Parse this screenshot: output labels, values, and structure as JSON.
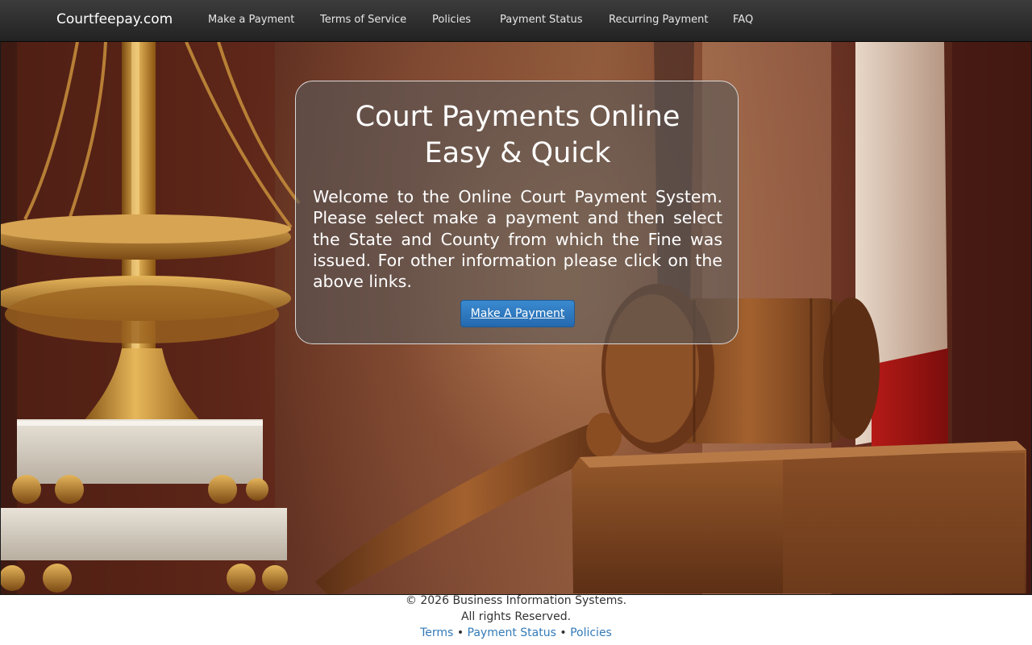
{
  "nav": {
    "brand": "Courtfeepay.com",
    "items": [
      {
        "label": "Make a Payment"
      },
      {
        "label": "Terms of Service"
      },
      {
        "label": "Policies"
      },
      {
        "label": "Payment Status"
      },
      {
        "label": "Recurring Payment"
      },
      {
        "label": "FAQ"
      }
    ]
  },
  "hero": {
    "title_line1": "Court Payments Online",
    "title_line2": "Easy & Quick",
    "body": "Welcome to the Online Court Payment System. Please select make a payment and then select the State and County from which the Fine was issued. For other information please click on the above links.",
    "cta_label": "Make A Payment"
  },
  "footer": {
    "copyright": "© 2026 Business Information Systems.",
    "rights": "All rights Reserved.",
    "links": [
      {
        "label": "Terms"
      },
      {
        "label": "Payment Status"
      },
      {
        "label": "Policies"
      }
    ],
    "separator": "•"
  },
  "colors": {
    "navbar": "#222222",
    "accent_button": "#2e77bd",
    "link": "#337ab7"
  }
}
